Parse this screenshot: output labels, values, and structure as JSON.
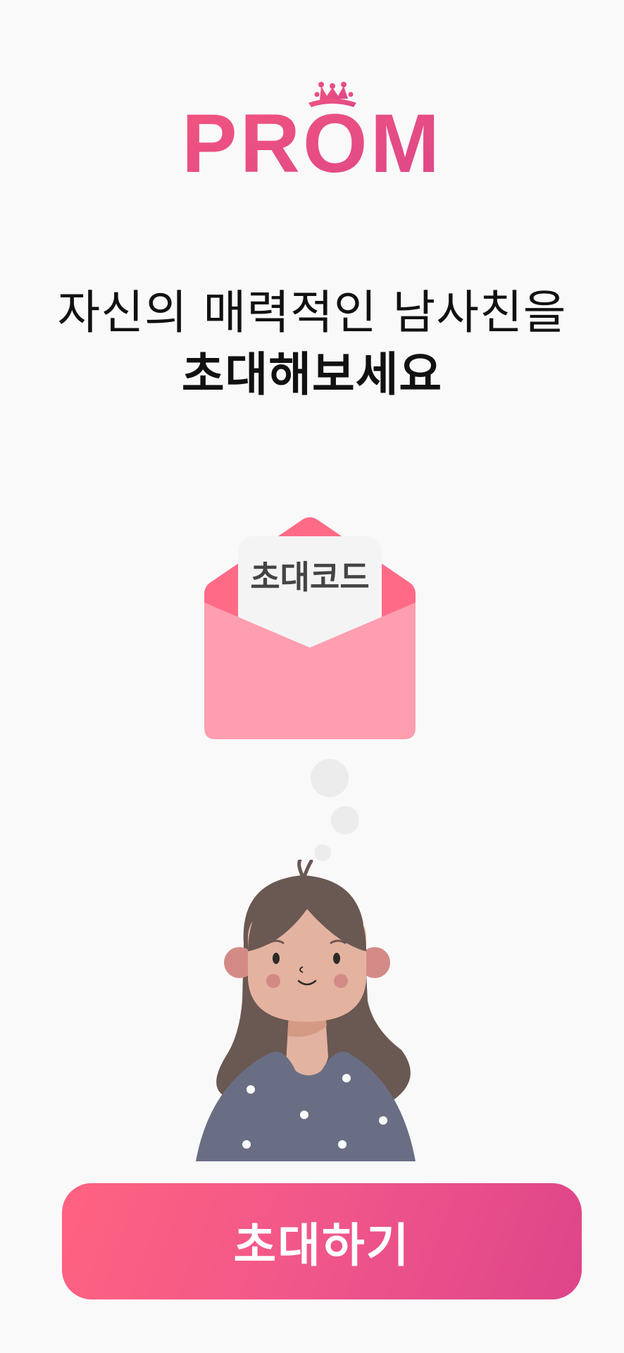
{
  "brand": {
    "logo_text": "PROM"
  },
  "headline": {
    "line1": "자신의 매력적인 남사친을",
    "line2": "초대해보세요"
  },
  "illustration": {
    "envelope_card_text": "초대코드",
    "envelope_icon": "envelope-icon",
    "thought_icon": "thought-bubble-icon",
    "person_icon": "girl-thinking-illustration"
  },
  "actions": {
    "invite_label": "초대하기"
  },
  "colors": {
    "brand_pink": "#ff6280",
    "brand_magenta": "#de4589",
    "envelope_pink": "#ff9eb0",
    "envelope_flap": "#ff6b86"
  }
}
